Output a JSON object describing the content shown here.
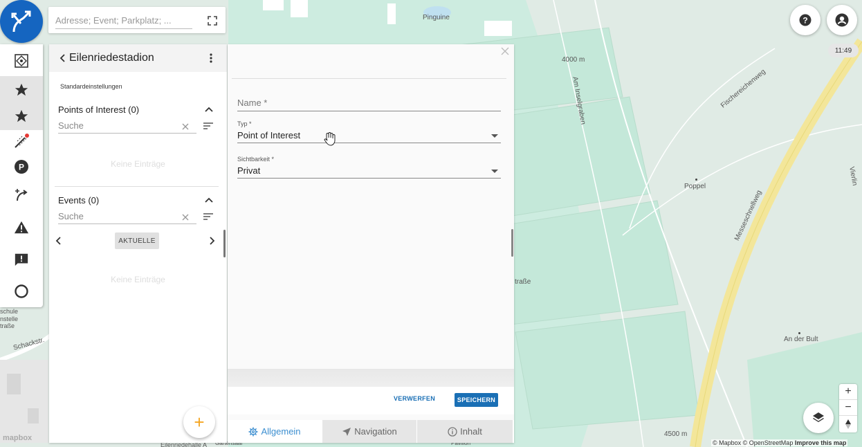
{
  "search": {
    "placeholder": "Adresse; Event; Parkplatz; ..."
  },
  "panel": {
    "title": "Eilenriedestadion",
    "subtitle": "Standardeinstellungen",
    "poi": {
      "title": "Points of Interest (0)",
      "search_placeholder": "Suche",
      "empty": "Keine Einträge"
    },
    "events": {
      "title": "Events (0)",
      "search_placeholder": "Suche",
      "pager_label": "AKTUELLE",
      "empty": "Keine Einträge"
    },
    "fab": "+"
  },
  "form": {
    "name": {
      "label": "Name *"
    },
    "type": {
      "label": "Typ *",
      "value": "Point of Interest"
    },
    "visibility": {
      "label": "Sichtbarkeit *",
      "value": "Privat"
    },
    "discard": "VERWERFEN",
    "save": "SPEICHERN",
    "tabs": [
      {
        "label": "Allgemein",
        "icon": "gear-icon"
      },
      {
        "label": "Navigation",
        "icon": "navigation-arrow-icon"
      },
      {
        "label": "Inhalt",
        "icon": "info-icon"
      }
    ]
  },
  "map": {
    "labels": {
      "pinguine": "Pinguine",
      "alt1": "4000 m",
      "street1": "Am Inselgraben",
      "street2": "Fischereichenweg",
      "poppel": "Poppel",
      "messe": "Messeschnellweg",
      "strasse": "traße",
      "bult": "An der Bult",
      "alt2": "4500 m",
      "schack": "Schackstr.",
      "left1": "schule",
      "left2": "nstelle",
      "left3": "traße",
      "bottom1": "Eilenriedehalle A",
      "bottom2": "Gartensaal",
      "bottom3": "Pavillon",
      "right_edge": "Vierlin"
    },
    "time": "11:49",
    "attribution": "© Mapbox © OpenStreetMap",
    "improve": "Improve this map",
    "mapbox_logo": "mapbox",
    "zoom_in": "+",
    "zoom_out": "−"
  },
  "colors": {
    "accent": "#1a6fb5",
    "logo": "#1565c0",
    "highway": "#f3e69a",
    "park": "#cfeee0"
  }
}
